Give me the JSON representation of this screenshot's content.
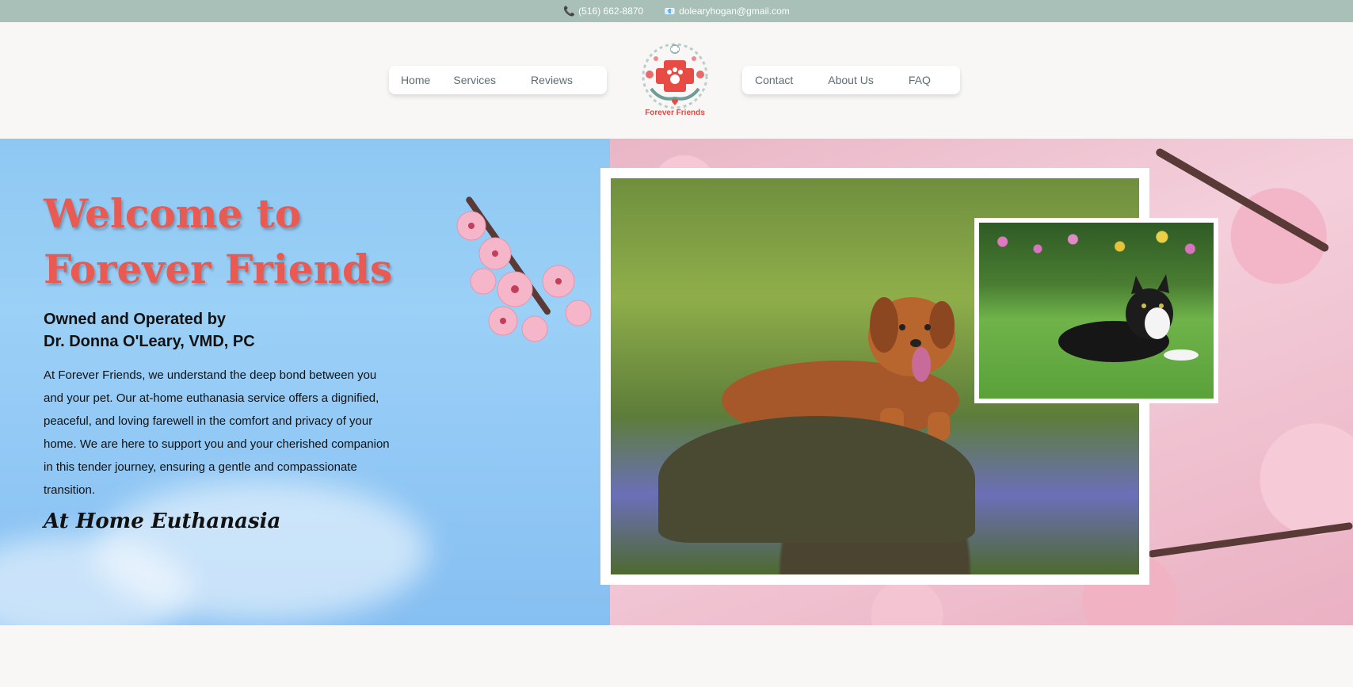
{
  "topbar": {
    "phone": "(516) 662-8870",
    "email": "dolearyhogan@gmail.com",
    "phone_icon": "phone-icon",
    "email_icon": "email-icon"
  },
  "nav": {
    "left": [
      "Home",
      "Services",
      "Reviews"
    ],
    "right": [
      "Contact",
      "About Us",
      "FAQ"
    ]
  },
  "logo": {
    "text": "Forever Friends",
    "icon": "paw-cross-icon"
  },
  "hero": {
    "title_line1": "Welcome to",
    "title_line2": "Forever Friends",
    "subtitle_line1": "Owned and Operated by",
    "subtitle_line2": "Dr. Donna O'Leary, VMD, PC",
    "body": "At Forever Friends, we understand the deep bond between you and your pet. Our at-home euthanasia service offers a dignified, peaceful, and loving farewell in the comfort and privacy of your home. We are here to support you and your cherished companion in this tender journey, ensuring a gentle and compassionate transition.",
    "tagline": "At Home Euthanasia"
  },
  "colors": {
    "topbar": "#a8c0b8",
    "accent": "#e85a52",
    "nav_text": "#5b6f72"
  }
}
